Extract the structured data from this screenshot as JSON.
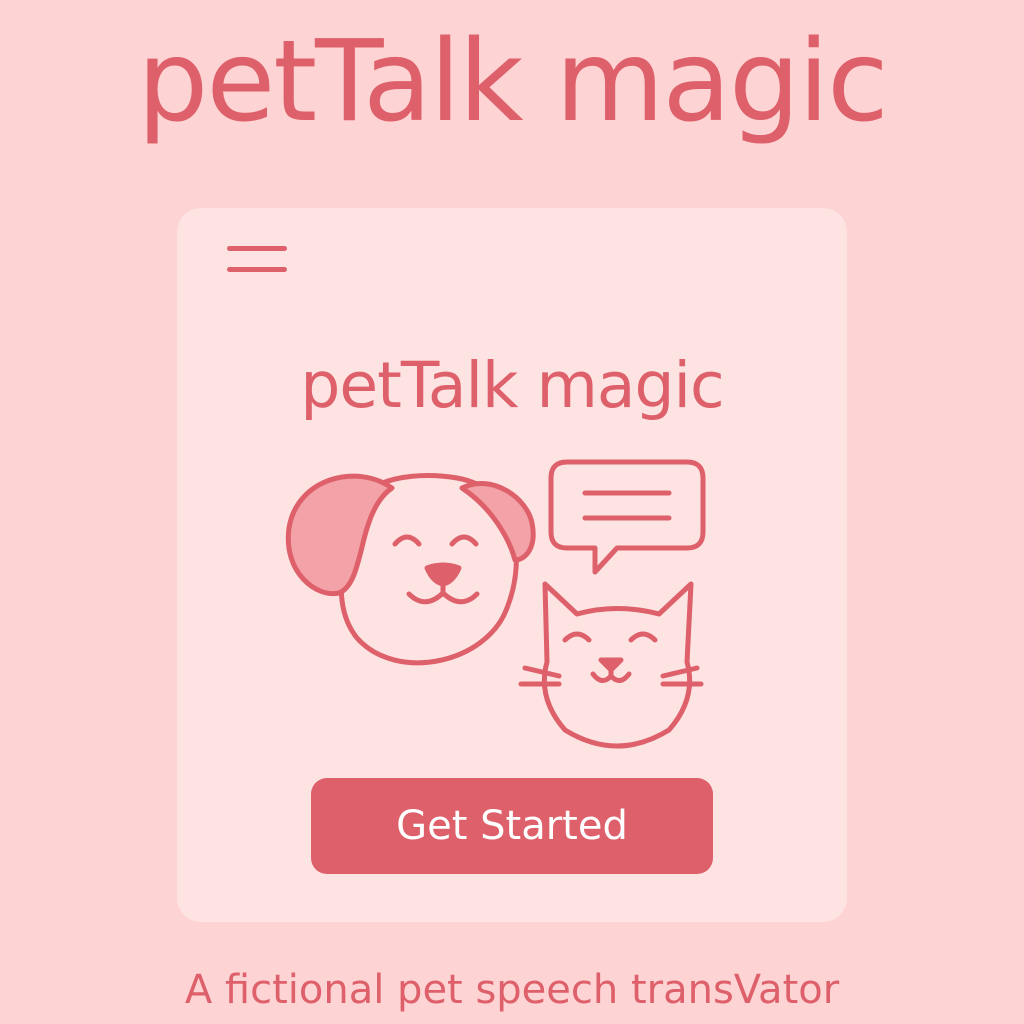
{
  "header": {
    "title": "petTalk magic"
  },
  "card": {
    "menu_icon": "hamburger-menu-icon",
    "title": "petTalk magic",
    "illustration": {
      "icons": [
        "dog-face-icon",
        "cat-face-icon",
        "speech-bubble-icon"
      ]
    },
    "cta_label": "Get Started"
  },
  "footer": {
    "tagline": "A fictional pet speech transVator"
  },
  "colors": {
    "background": "#fdd3d4",
    "card": "#fde3e2",
    "accent": "#de606a",
    "ear_fill": "#f3a3a7",
    "button_text": "#ffffff"
  }
}
